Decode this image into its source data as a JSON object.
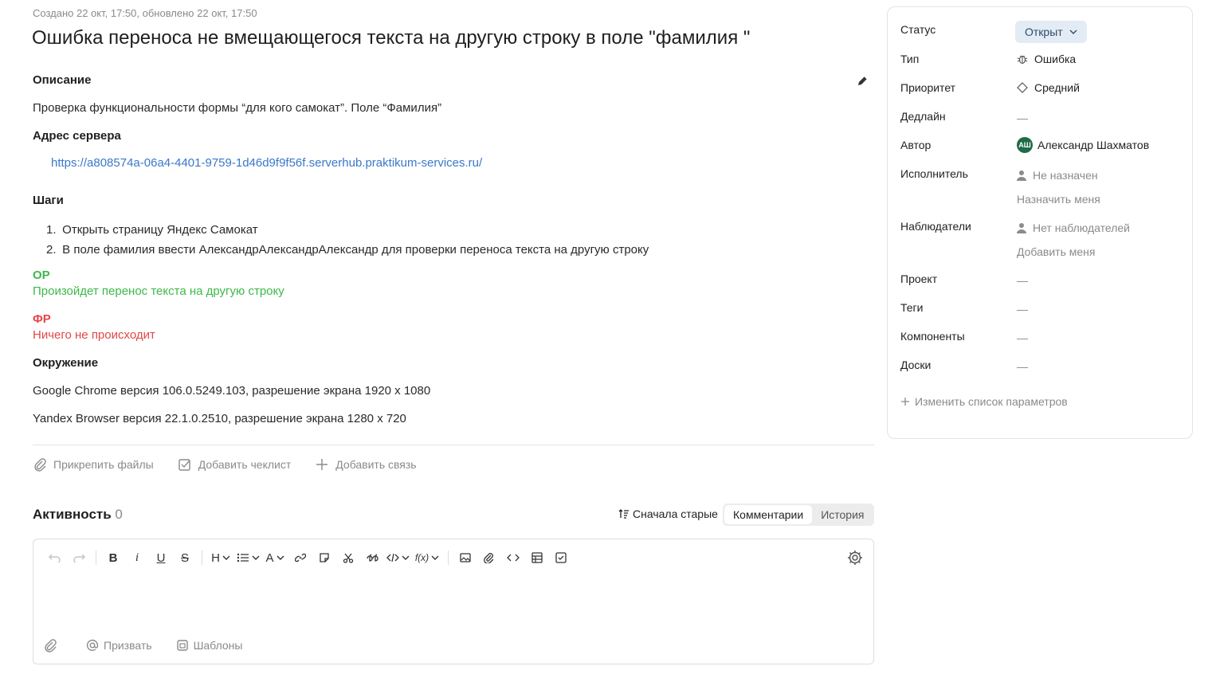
{
  "meta": "Создано 22 окт, 17:50, обновлено 22 окт, 17:50",
  "title": "Ошибка переноса не вмещающегося текста на другую строку в поле \"фамилия \"",
  "description": {
    "heading": "Описание",
    "text": "Проверка функциональности формы “для кого самокат”. Поле “Фамилия”",
    "server_heading": "Адрес сервера",
    "server_url": "https://a808574a-06a4-4401-9759-1d46d9f9f56f.serverhub.praktikum-services.ru/",
    "steps_heading": "Шаги",
    "steps": [
      {
        "num": "1.",
        "text": "Открыть страницу Яндекс Самокат"
      },
      {
        "num": "2.",
        "text": "В поле фамилия ввести АлександрАлександрАлександр для проверки переноса текста на другую строку"
      }
    ],
    "expected_heading": "ОР",
    "expected_text": "Произойдет перенос текста на другую строку",
    "actual_heading": "ФР",
    "actual_text": "Ничего не происходит",
    "env_heading": "Окружение",
    "env_lines": [
      "Google Chrome версия 106.0.5249.103, разрешение экрана 1920 x 1080",
      "Yandex Browser версия 22.1.0.2510, разрешение экрана 1280 x 720"
    ],
    "expected_color": "#3db84a",
    "actual_color": "#e54545"
  },
  "actions": {
    "attach": "Прикрепить файлы",
    "checklist": "Добавить чеклист",
    "link": "Добавить связь"
  },
  "activity": {
    "heading": "Активность",
    "count": "0",
    "sort": "Сначала старые",
    "tabs": [
      "Комментарии",
      "История"
    ],
    "active_tab": "Комментарии"
  },
  "editor": {
    "toolbar": [
      "undo-icon",
      "redo-icon",
      "B",
      "i",
      "U",
      "S",
      "H",
      "list-icon",
      "A",
      "link-icon",
      "note-icon",
      "cut-icon",
      "quote-icon",
      "code-block-icon",
      "formula-icon",
      "image-icon",
      "attach-icon",
      "code-icon",
      "table-icon",
      "checkbox-icon",
      "settings-icon"
    ],
    "mention": "Призвать",
    "templates": "Шаблоны"
  },
  "sidebar": {
    "status_label": "Статус",
    "status_value": "Открыт",
    "type_label": "Тип",
    "type_value": "Ошибка",
    "priority_label": "Приоритет",
    "priority_value": "Средний",
    "deadline_label": "Дедлайн",
    "deadline_value": "—",
    "author_label": "Автор",
    "author_initials": "АШ",
    "author_value": "Александр Шахматов",
    "assignee_label": "Исполнитель",
    "assignee_value": "Не назначен",
    "assign_me": "Назначить меня",
    "watchers_label": "Наблюдатели",
    "watchers_value": "Нет наблюдателей",
    "add_me": "Добавить меня",
    "project_label": "Проект",
    "project_value": "—",
    "tags_label": "Теги",
    "tags_value": "—",
    "components_label": "Компоненты",
    "components_value": "—",
    "boards_label": "Доски",
    "boards_value": "—",
    "change_params": "Изменить список параметров",
    "status_bg": "#e3ecf5",
    "avatar_color": "#1e6b4a"
  }
}
